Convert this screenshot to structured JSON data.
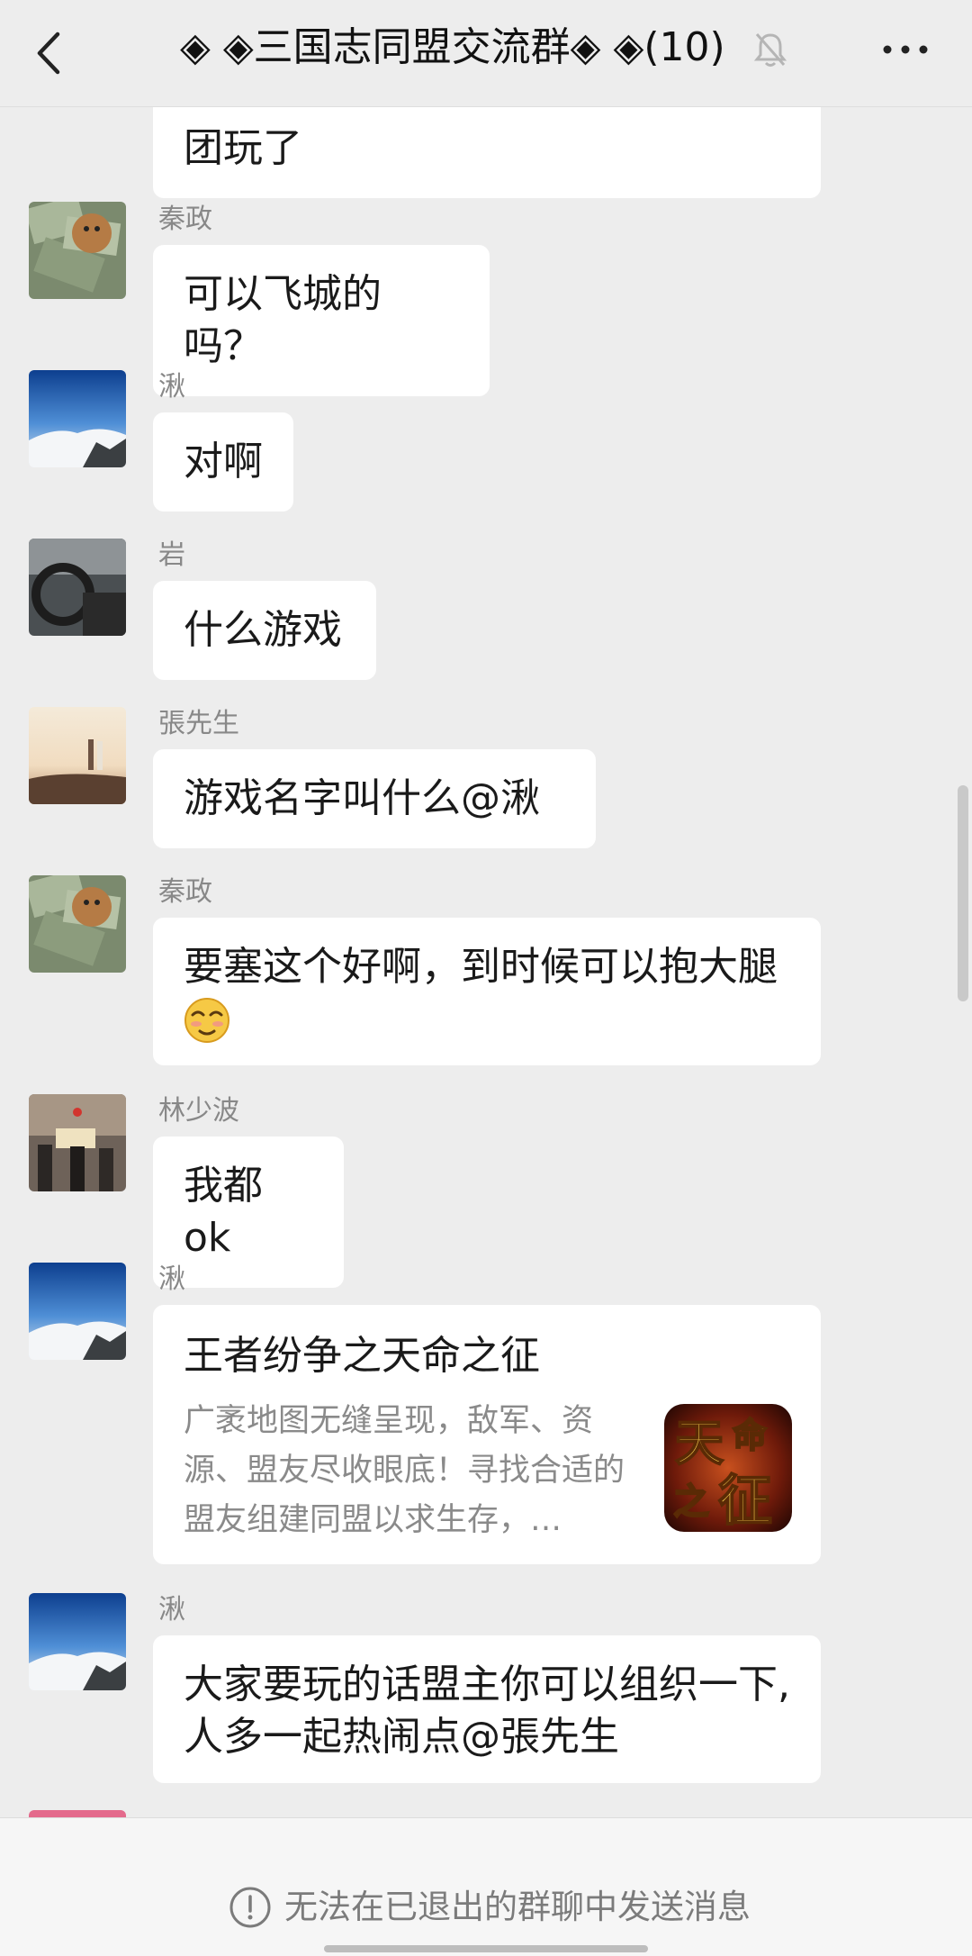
{
  "header": {
    "title": "◈ ◈三国志同盟交流群◈ ◈(10)",
    "back_icon": "chevron-left-icon",
    "mute_icon": "bell-off-icon",
    "more_icon": "more-dots-icon"
  },
  "messages": [
    {
      "text": "团玩了"
    },
    {
      "sender": "秦政",
      "text": "可以飞城的吗？"
    },
    {
      "sender": "湫",
      "text": "对啊"
    },
    {
      "sender": "岩",
      "text": "什么游戏"
    },
    {
      "sender": "張先生",
      "text": "游戏名字叫什么@湫"
    },
    {
      "sender": "秦政",
      "text": "要塞这个好啊，到时候可以抱大腿"
    },
    {
      "sender": "林少波",
      "text": "我都 ok"
    },
    {
      "sender": "湫",
      "card_title": "王者纷争之天命之征",
      "card_desc": "广袤地图无缝呈现，敌军、资源、盟友尽收眼底！寻找合适的盟友组建同盟以求生存，…",
      "card_icon_text": "天命之征"
    },
    {
      "sender": "湫",
      "text_line1": "大家要玩的话盟主你可以组织一下,",
      "text_line2": "人多一起热闹点@張先生"
    }
  ],
  "footer": {
    "notice": "无法在已退出的群聊中发送消息",
    "icon": "info-circle-icon"
  }
}
